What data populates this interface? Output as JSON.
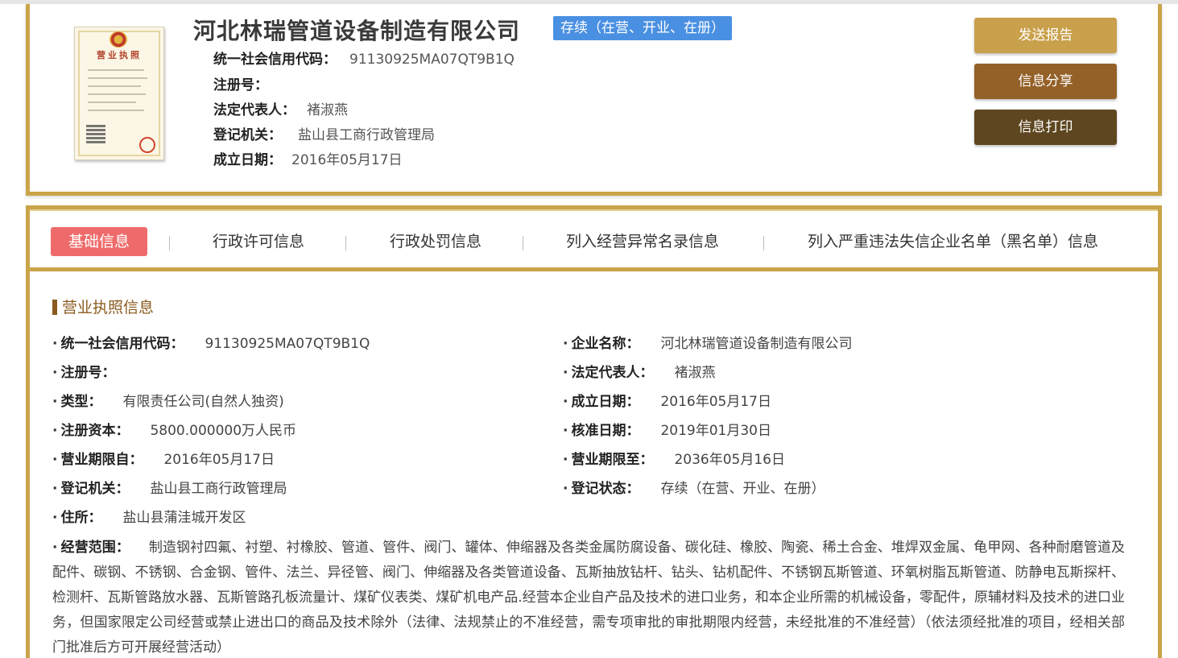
{
  "header": {
    "company_name": "河北林瑞管道设备制造有限公司",
    "status": "存续（在营、开业、在册）",
    "license_image_title": "营业执照",
    "rows": [
      {
        "label": "统一社会信用代码：",
        "value": "91130925MA07QT9B1Q"
      },
      {
        "label": "注册号：",
        "value": ""
      },
      {
        "label": "法定代表人：",
        "value": "褚淑燕"
      },
      {
        "label": "登记机关：",
        "value": "盐山县工商行政管理局"
      },
      {
        "label": "成立日期：",
        "value": "2016年05月17日"
      }
    ],
    "buttons": [
      {
        "label": "发送报告",
        "color": "#c9a04b"
      },
      {
        "label": "信息分享",
        "color": "#946128"
      },
      {
        "label": "信息打印",
        "color": "#5e4720"
      }
    ]
  },
  "tabs": [
    {
      "label": "基础信息",
      "active": true
    },
    {
      "label": "行政许可信息",
      "active": false
    },
    {
      "label": "行政处罚信息",
      "active": false
    },
    {
      "label": "列入经营异常名录信息",
      "active": false
    },
    {
      "label": "列入严重违法失信企业名单（黑名单）信息",
      "active": false
    }
  ],
  "section": {
    "title": "营业执照信息",
    "left": [
      {
        "label": "统一社会信用代码：",
        "value": "91130925MA07QT9B1Q"
      },
      {
        "label": "注册号：",
        "value": ""
      },
      {
        "label": "类型：",
        "value": "有限责任公司(自然人独资)"
      },
      {
        "label": "注册资本：",
        "value": "5800.000000万人民币"
      },
      {
        "label": "营业期限自：",
        "value": "2016年05月17日"
      },
      {
        "label": "登记机关：",
        "value": "盐山县工商行政管理局"
      },
      {
        "label": "住所：",
        "value": "盐山县蒲洼城开发区"
      }
    ],
    "right": [
      {
        "label": "企业名称：",
        "value": "河北林瑞管道设备制造有限公司"
      },
      {
        "label": "法定代表人：",
        "value": "褚淑燕"
      },
      {
        "label": "成立日期：",
        "value": "2016年05月17日"
      },
      {
        "label": "核准日期：",
        "value": "2019年01月30日"
      },
      {
        "label": "营业期限至：",
        "value": "2036年05月16日"
      },
      {
        "label": "登记状态：",
        "value": "存续（在营、开业、在册）"
      }
    ],
    "scope": {
      "label": "经营范围：",
      "value": "制造钢衬四氟、衬塑、衬橡胶、管道、管件、阀门、罐体、伸缩器及各类金属防腐设备、碳化硅、橡胶、陶瓷、稀土合金、堆焊双金属、龟甲网、各种耐磨管道及配件、碳钢、不锈钢、合金钢、管件、法兰、异径管、阀门、伸缩器及各类管道设备、瓦斯抽放钻杆、钻头、钻机配件、不锈钢瓦斯管道、环氧树脂瓦斯管道、防静电瓦斯探杆、检测杆、瓦斯管路放水器、瓦斯管路孔板流量计、煤矿仪表类、煤矿机电产品.经营本企业自产品及技术的进口业务，和本企业所需的机械设备，零配件，原辅材料及技术的进口业务，但国家限定公司经营或禁止进出口的商品及技术除外（法律、法规禁止的不准经营，需专项审批的审批期限内经营，未经批准的不准经营）（依法须经批准的项目，经相关部门批准后方可开展经营活动）"
    }
  },
  "colors": {
    "gold": "#c9a449",
    "active_tab": "#ef6b6b",
    "status_blue": "#4a90e2",
    "section_brown": "#8a5a1e"
  }
}
